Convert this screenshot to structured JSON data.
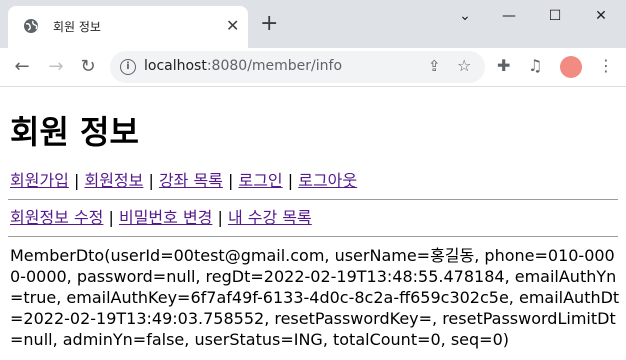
{
  "browser": {
    "tab_title": "회원 정보",
    "url_host": "localhost",
    "url_path": ":8080/member/info"
  },
  "page": {
    "heading": "회원 정보",
    "nav_links": [
      "회원가입",
      "회원정보",
      "강좌 목록",
      "로그인",
      "로그아웃"
    ],
    "sub_links": [
      "회원정보 수정",
      "비밀번호 변경",
      "내 수강 목록"
    ],
    "separator": "|",
    "dto_text": "MemberDto(userId=00test@gmail.com, userName=홍길동, phone=010-0000-0000, password=null, regDt=2022-02-19T13:48:55.478184, emailAuthYn=true, emailAuthKey=6f7af49f-6133-4d0c-8c2a-ff659c302c5e, emailAuthDt=2022-02-19T13:49:03.758552, resetPasswordKey=, resetPasswordLimitDt=null, adminYn=false, userStatus=ING, totalCount=0, seq=0)"
  }
}
